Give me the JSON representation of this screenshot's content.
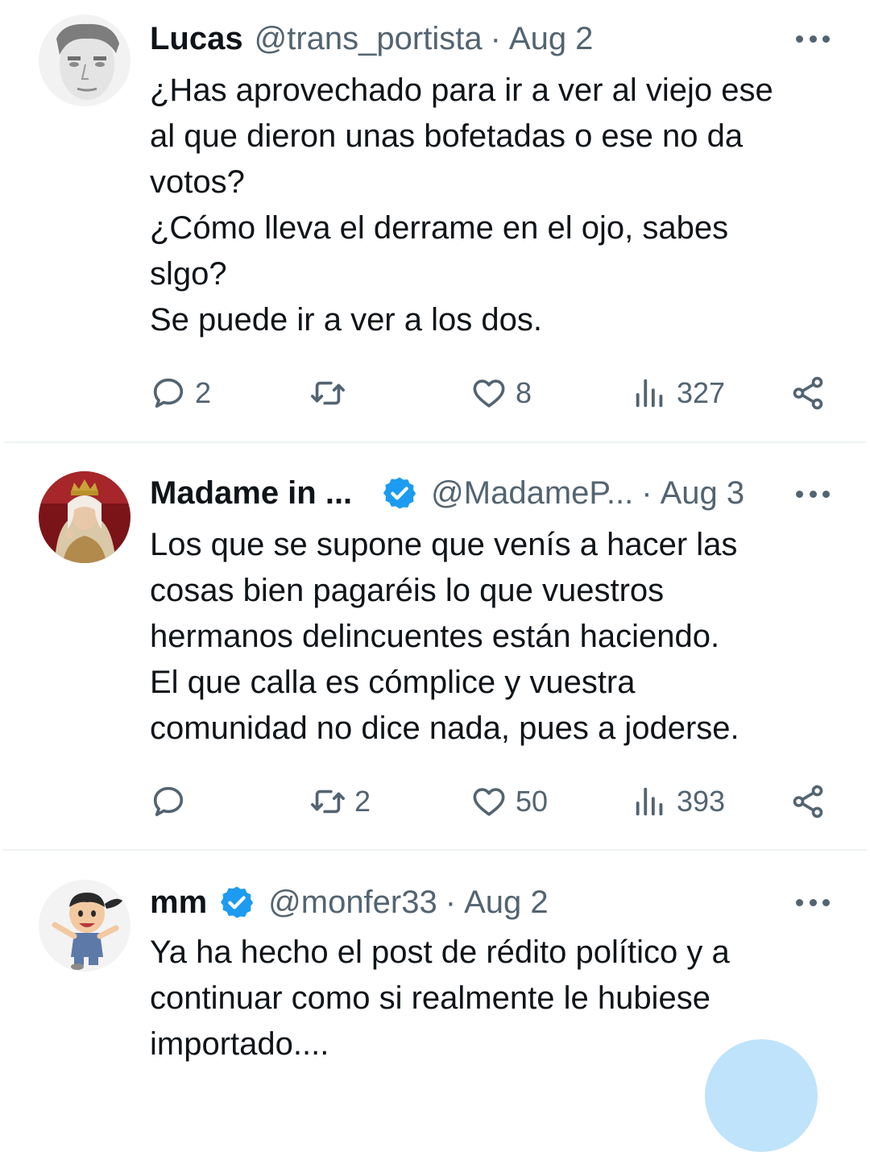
{
  "tweets": [
    {
      "name": "Lucas",
      "handle": "@trans_portista",
      "separator": "·",
      "time": "Aug 2",
      "verified": false,
      "lines": [
        "¿Has aprovechado para ir a ver al viejo ese",
        "al que dieron unas bofetadas o ese no da",
        "votos?",
        "¿Cómo lleva el derrame en el ojo, sabes",
        "slgo?",
        "Se puede ir a ver a los dos."
      ],
      "replies": "2",
      "retweets": "",
      "likes": "8",
      "views": "327"
    },
    {
      "name": "Madame in ...",
      "handle": "@MadameP...",
      "separator": "·",
      "time": "Aug 3",
      "verified": true,
      "lines": [
        "Los que se supone que venís a hacer las",
        "cosas bien pagaréis lo que vuestros",
        "hermanos delincuentes están haciendo.",
        "El que calla es cómplice y vuestra",
        "comunidad no dice nada, pues a joderse."
      ],
      "replies": "",
      "retweets": "2",
      "likes": "50",
      "views": "393"
    },
    {
      "name": "mm",
      "handle": "@monfer33",
      "separator": "·",
      "time": "Aug 2",
      "verified": true,
      "lines": [
        "Ya ha hecho el post de rédito político y a",
        "continuar como si realmente le hubiese",
        "importado...."
      ]
    }
  ],
  "icons": {
    "reply": "reply-icon",
    "retweet": "retweet-icon",
    "like": "heart-icon",
    "views": "views-icon",
    "share": "share-icon",
    "verified": "verified-badge-icon",
    "more": "more-icon"
  },
  "colors": {
    "text": "#0f1419",
    "secondary": "#536471",
    "verified": "#1d9bf0",
    "divider": "#eff3f4"
  }
}
